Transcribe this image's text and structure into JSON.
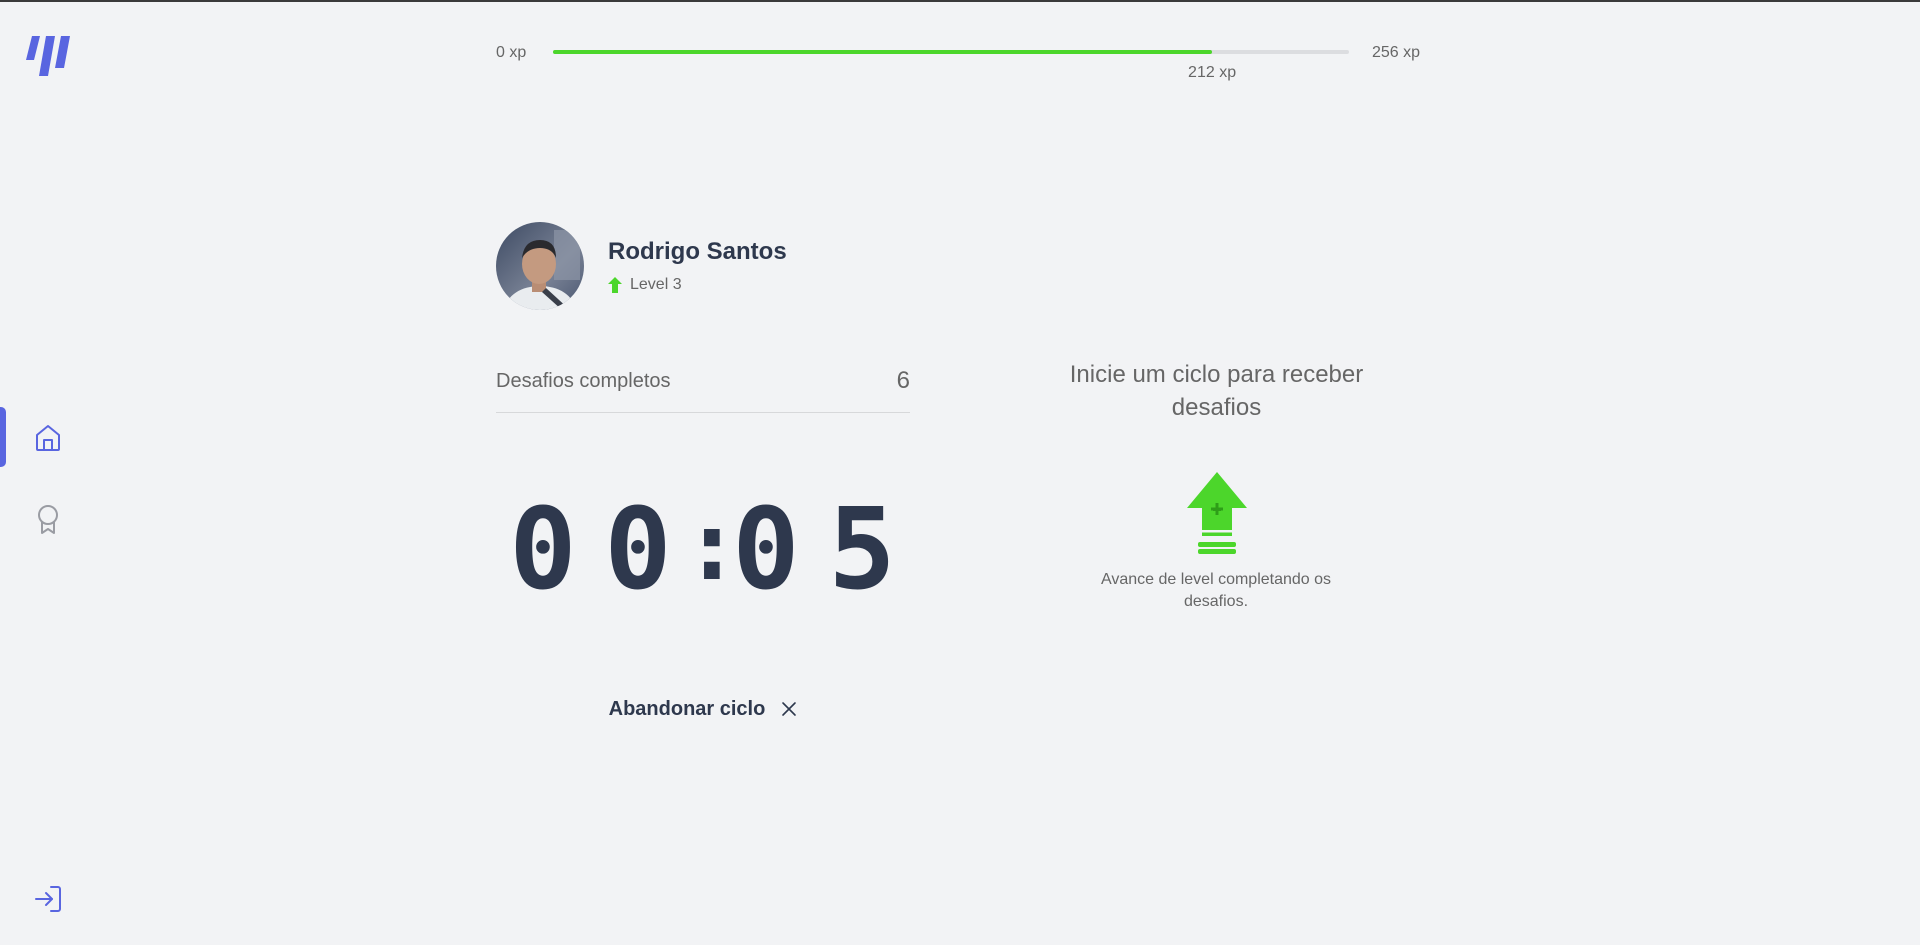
{
  "sidebar": {
    "logo_name": "moveit-logo",
    "nav": [
      {
        "name": "home",
        "icon": "home-icon",
        "active": true
      },
      {
        "name": "leaderboard",
        "icon": "award-icon",
        "active": false
      }
    ],
    "logout_icon": "logout-icon"
  },
  "xp": {
    "min_label": "0 xp",
    "max_label": "256 xp",
    "current_label": "212 xp",
    "current": 212,
    "max": 256,
    "progress_fraction": 0.828
  },
  "profile": {
    "name": "Rodrigo Santos",
    "level_label": "Level 3"
  },
  "completed_challenges": {
    "label": "Desafios completos",
    "value": "6"
  },
  "countdown": {
    "minute_left": "0",
    "minute_right": "0",
    "separator": ":",
    "second_left": "0",
    "second_right": "5"
  },
  "abandon_button": {
    "label": "Abandonar ciclo"
  },
  "challenge_box": {
    "title": "Inicie um ciclo para receber desafios",
    "hint": "Avance de level completando os desafios."
  },
  "colors": {
    "accent": "#5965E0",
    "green": "#4CD62B",
    "background": "#F2F3F5",
    "title": "#2E384D",
    "text": "#666666"
  }
}
